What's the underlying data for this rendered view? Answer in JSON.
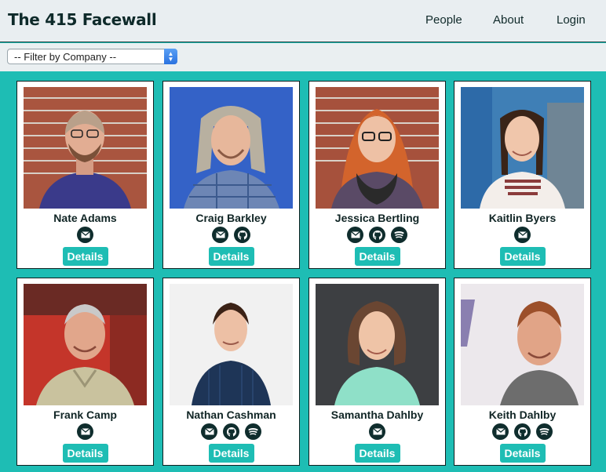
{
  "app": {
    "title": "The 415 Facewall"
  },
  "nav": {
    "people": "People",
    "about": "About",
    "login": "Login"
  },
  "filter": {
    "selected": "-- Filter by Company --"
  },
  "colors": {
    "accent": "#1ebdb4",
    "dark": "#0f2d2d"
  },
  "people": [
    {
      "name": "Nate Adams",
      "icons": [
        "email-icon"
      ]
    },
    {
      "name": "Craig Barkley",
      "icons": [
        "email-icon",
        "github-icon"
      ]
    },
    {
      "name": "Jessica Bertling",
      "icons": [
        "email-icon",
        "github-icon",
        "spotify-icon"
      ]
    },
    {
      "name": "Kaitlin Byers",
      "icons": [
        "email-icon"
      ]
    },
    {
      "name": "Frank Camp",
      "icons": [
        "email-icon"
      ]
    },
    {
      "name": "Nathan Cashman",
      "icons": [
        "email-icon",
        "github-icon",
        "spotify-icon"
      ]
    },
    {
      "name": "Samantha Dahlby",
      "icons": [
        "email-icon"
      ]
    },
    {
      "name": "Keith Dahlby",
      "icons": [
        "email-icon",
        "github-icon",
        "spotify-icon"
      ]
    }
  ],
  "details_label": "Details"
}
